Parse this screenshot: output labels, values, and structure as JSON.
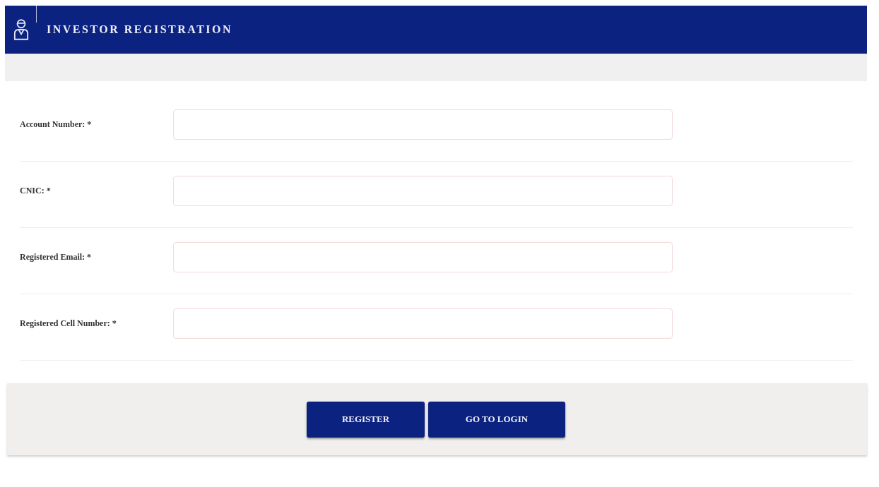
{
  "header": {
    "title": "INVESTOR REGISTRATION"
  },
  "fields": [
    {
      "label": "Account Number: *"
    },
    {
      "label": "CNIC: *"
    },
    {
      "label": "Registered Email: *"
    },
    {
      "label": "Registered Cell Number: *"
    }
  ],
  "buttons": [
    "REGISTER",
    "GO TO LOGIN"
  ]
}
